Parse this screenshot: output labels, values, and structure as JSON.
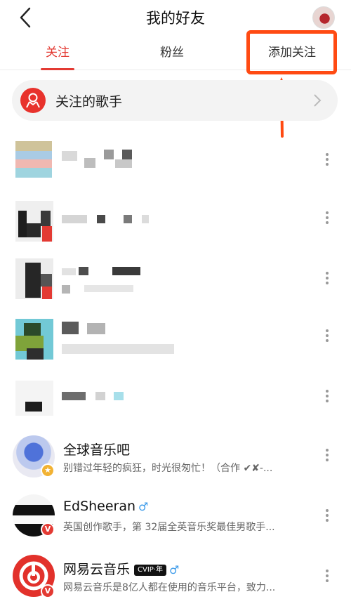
{
  "header": {
    "title": "我的好友"
  },
  "tabs": [
    {
      "label": "关注",
      "active": true
    },
    {
      "label": "粉丝",
      "active": false
    },
    {
      "label": "添加关注",
      "active": false
    }
  ],
  "singers": {
    "label": "关注的歌手"
  },
  "users": [
    {
      "name": "全球音乐吧",
      "desc": "别错过年轻的疯狂，时光很匆忙！（合作 ✔✘-...",
      "badge": "star"
    },
    {
      "name": "EdSheeran",
      "gender": "♂",
      "desc": "英国创作歌手，第 32届全英音乐奖最佳男歌手...",
      "badge": "V"
    },
    {
      "name": "网易云音乐",
      "vip": "CVIP·年",
      "gender": "♂",
      "desc": "网易云音乐是8亿人都在使用的音乐平台，致力...",
      "badge": "V"
    }
  ],
  "colors": {
    "accent": "#e33a33",
    "annotation": "#ff4a12",
    "male": "#3d9be9"
  }
}
